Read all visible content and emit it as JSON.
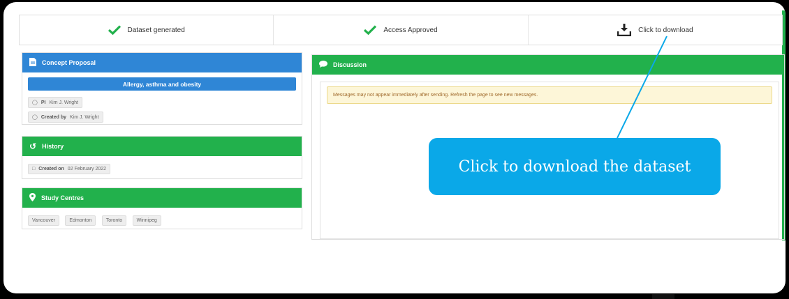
{
  "stepper": {
    "steps": [
      {
        "label": "Dataset generated",
        "icon": "check-icon"
      },
      {
        "label": "Access Approved",
        "icon": "check-icon"
      },
      {
        "label": "Click to download",
        "icon": "download-icon"
      }
    ]
  },
  "concept_proposal": {
    "header": "Concept Proposal",
    "title": "Allergy, asthma and obesity",
    "pi_label": "PI",
    "pi_value": "Kim J. Wright",
    "created_by_label": "Created by",
    "created_by_value": "Kim J. Wright"
  },
  "history": {
    "header": "History",
    "created_on_label": "Created on",
    "created_on_value": "02 February 2022"
  },
  "study_centres": {
    "header": "Study Centres",
    "items": [
      "Vancouver",
      "Edmonton",
      "Toronto",
      "Winnipeg"
    ]
  },
  "discussion": {
    "header": "Discussion",
    "notice": "Messages may not appear immediately after sending. Refresh the page to see new messages."
  },
  "callout": {
    "text": "Click to download the dataset"
  },
  "colors": {
    "green": "#22b14c",
    "blue": "#2f86d6",
    "callout": "#0aa8e8"
  }
}
